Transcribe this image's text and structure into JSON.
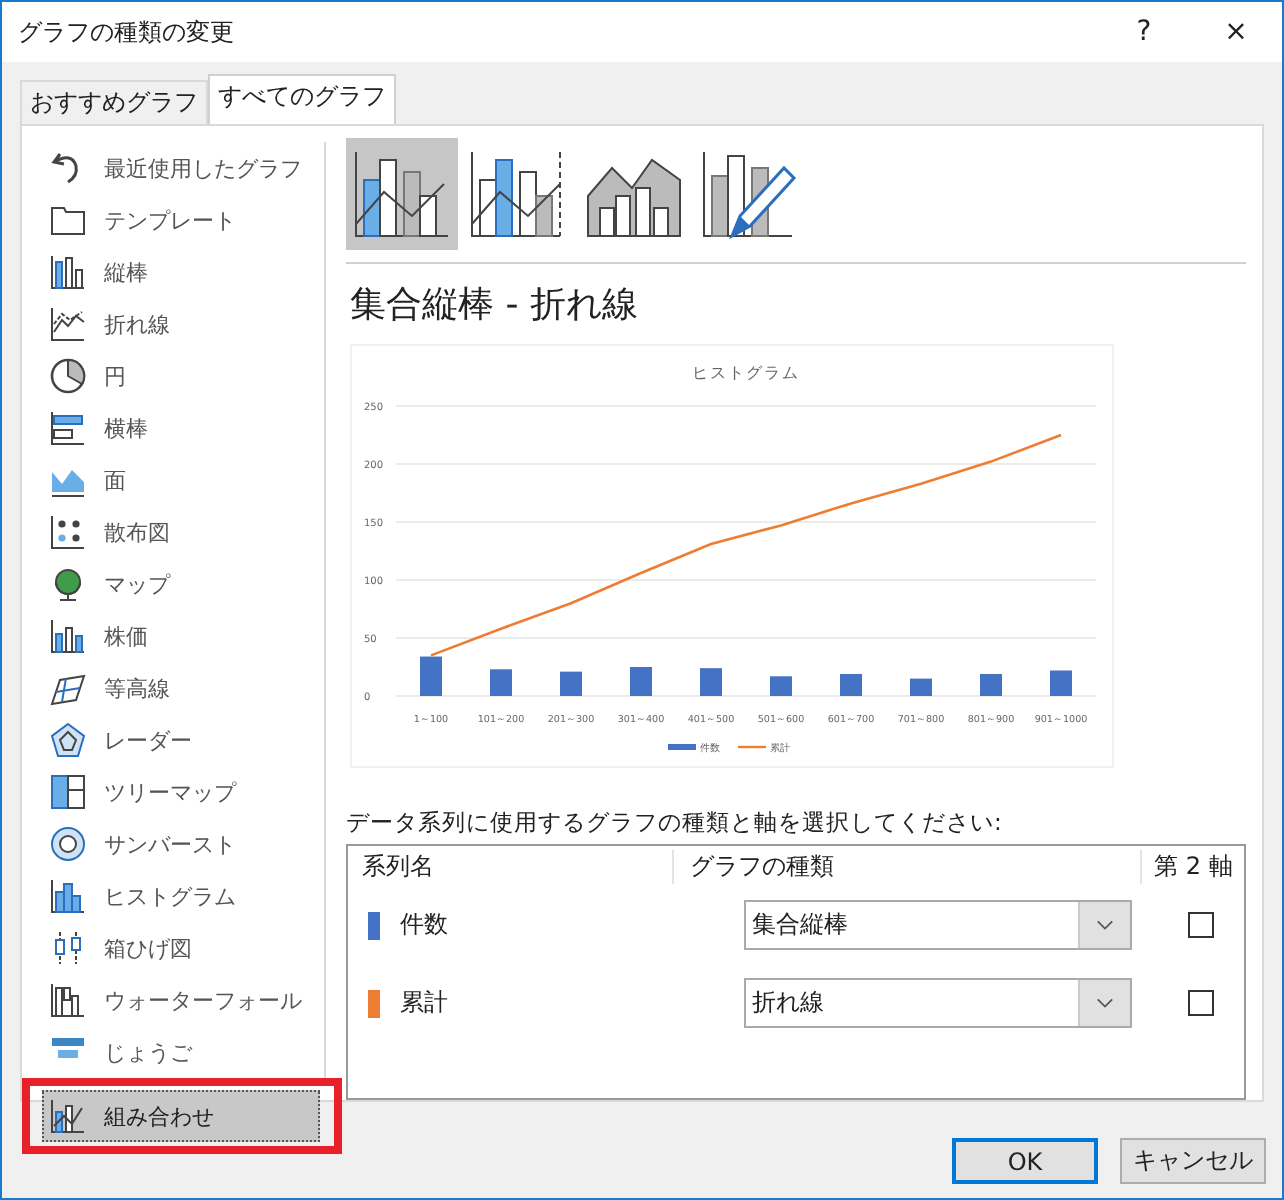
{
  "window": {
    "title": "グラフの種類の変更",
    "help": "?",
    "close": "×"
  },
  "tabs": [
    {
      "label": "おすすめグラフ",
      "selected": false
    },
    {
      "label": "すべてのグラフ",
      "selected": true
    }
  ],
  "sidebar": {
    "items": [
      {
        "label": "最近使用したグラフ",
        "selected": false
      },
      {
        "label": "テンプレート",
        "selected": false
      },
      {
        "label": "縦棒",
        "selected": false
      },
      {
        "label": "折れ線",
        "selected": false
      },
      {
        "label": "円",
        "selected": false
      },
      {
        "label": "横棒",
        "selected": false
      },
      {
        "label": "面",
        "selected": false
      },
      {
        "label": "散布図",
        "selected": false
      },
      {
        "label": "マップ",
        "selected": false
      },
      {
        "label": "株価",
        "selected": false
      },
      {
        "label": "等高線",
        "selected": false
      },
      {
        "label": "レーダー",
        "selected": false
      },
      {
        "label": "ツリーマップ",
        "selected": false
      },
      {
        "label": "サンバースト",
        "selected": false
      },
      {
        "label": "ヒストグラム",
        "selected": false
      },
      {
        "label": "箱ひげ図",
        "selected": false
      },
      {
        "label": "ウォーターフォール",
        "selected": false
      },
      {
        "label": "じょうご",
        "selected": false
      },
      {
        "label": "組み合わせ",
        "selected": true,
        "highlighted": true
      }
    ]
  },
  "subtypes": [
    {
      "selected": true
    },
    {
      "selected": false
    },
    {
      "selected": false
    },
    {
      "selected": false
    }
  ],
  "preview": {
    "heading": "集合縦棒 - 折れ線",
    "chart_data": {
      "type": "bar",
      "title": "ヒストグラム",
      "categories": [
        "1～100",
        "101～200",
        "201～300",
        "301～400",
        "401～500",
        "501～600",
        "601～700",
        "701～800",
        "801～900",
        "901～1000"
      ],
      "series": [
        {
          "name": "件数",
          "color": "#4472c4",
          "type": "bar",
          "values": [
            34,
            23,
            21,
            25,
            24,
            17,
            19,
            15,
            19,
            22
          ]
        },
        {
          "name": "累計",
          "color": "#ed7d31",
          "type": "line",
          "values": [
            35,
            58,
            80,
            106,
            131,
            147,
            166,
            183,
            202,
            225
          ]
        }
      ],
      "ylim": [
        0,
        250
      ],
      "yticks": [
        0,
        50,
        100,
        150,
        200,
        250
      ],
      "grid": true,
      "legend": "bottom"
    }
  },
  "series_table": {
    "prompt": "データ系列に使用するグラフの種類と軸を選択してください:",
    "columns": [
      "系列名",
      "グラフの種類",
      "第 2 軸"
    ],
    "rows": [
      {
        "name": "件数",
        "color": "#4472c4",
        "chart_type": "集合縦棒",
        "secondary_axis": false
      },
      {
        "name": "累計",
        "color": "#ed7d31",
        "chart_type": "折れ線",
        "secondary_axis": false
      }
    ]
  },
  "buttons": [
    {
      "label": "OK",
      "kind": "default"
    },
    {
      "label": "キャンセル",
      "kind": "normal"
    }
  ]
}
